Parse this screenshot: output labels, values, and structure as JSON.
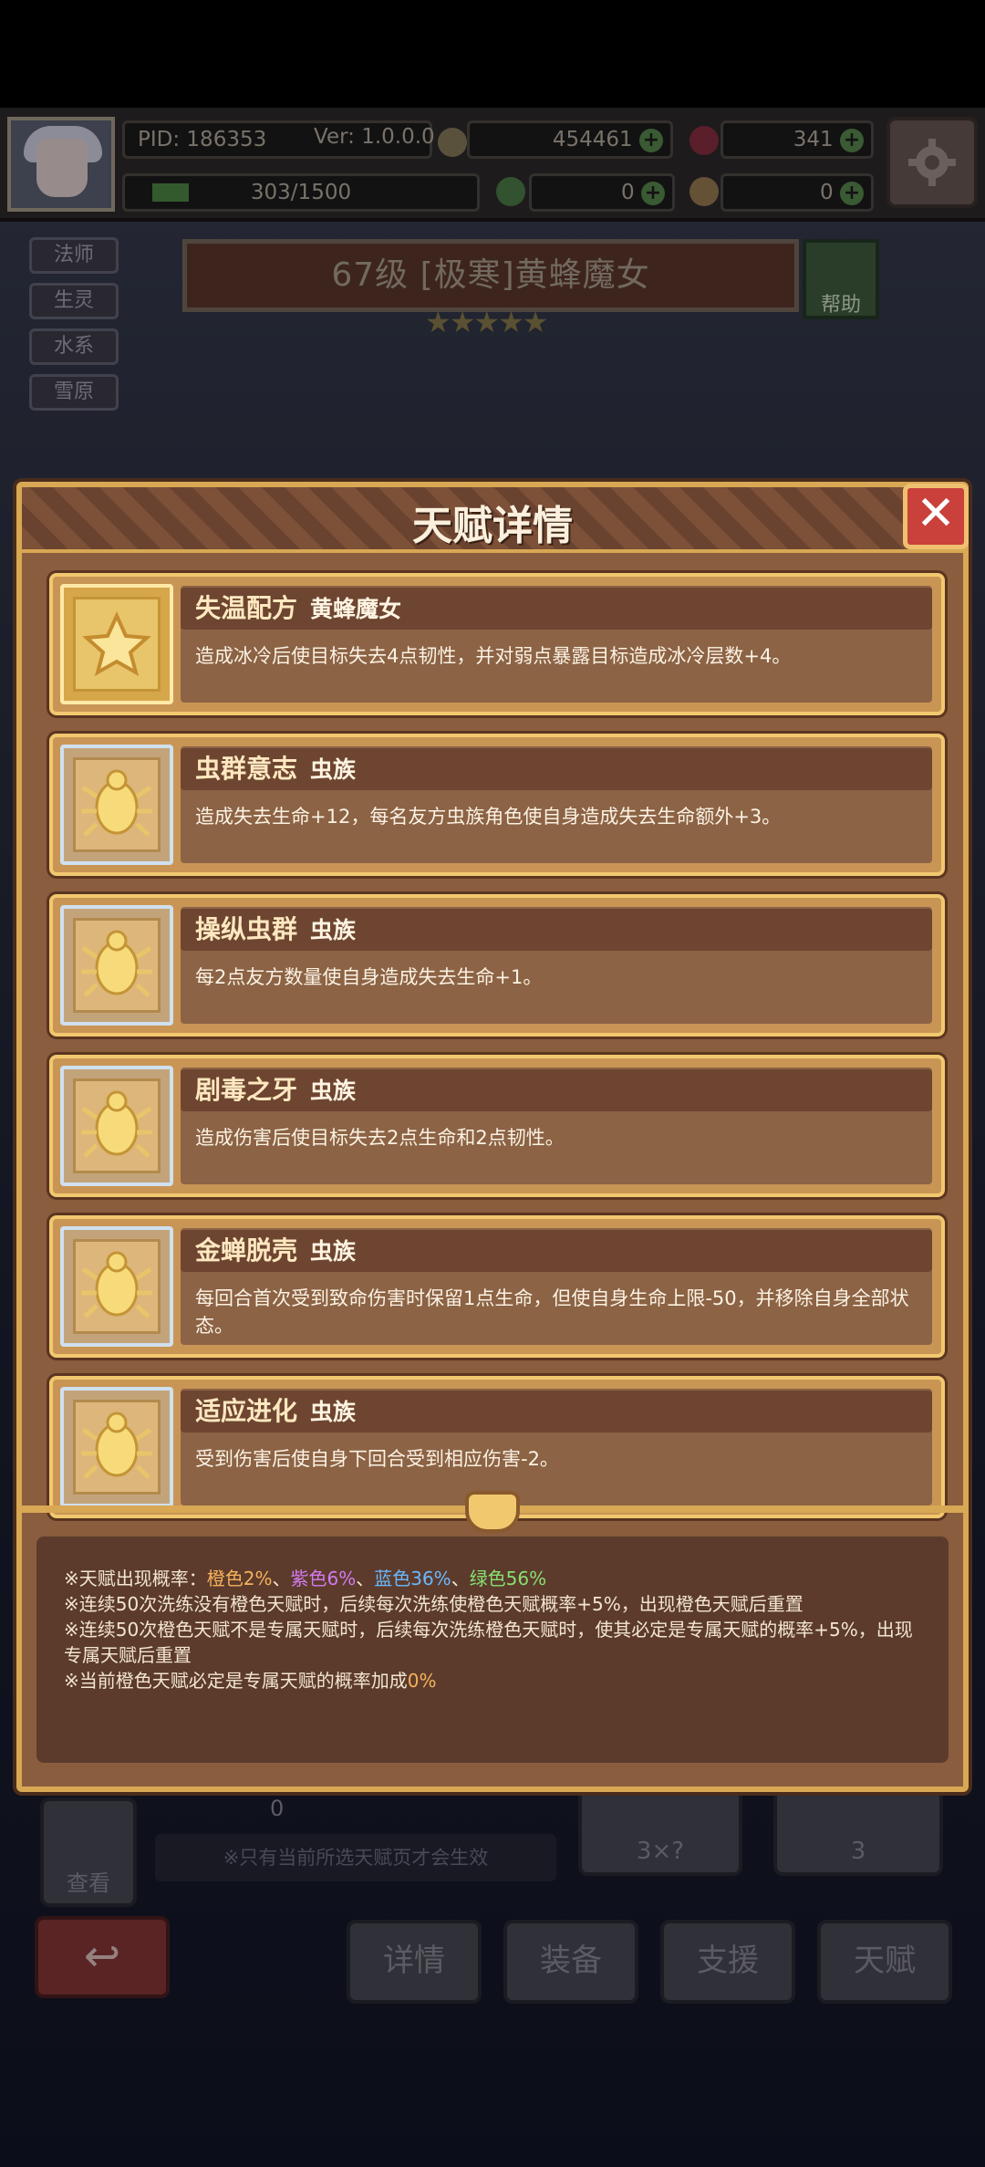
{
  "hud": {
    "pid": "PID: 186353",
    "version": "Ver: 1.0.0.0",
    "gold": "454461",
    "gems": "341",
    "exp": "303/1500",
    "clover": "0",
    "material": "0"
  },
  "tags": [
    "法师",
    "生灵",
    "水系",
    "雪原"
  ],
  "hero": {
    "title": "67级  [极寒]黄蜂魔女",
    "stars": "★★★★★",
    "help_label": "帮助"
  },
  "modal": {
    "title": "天赋详情",
    "close_label": "✕",
    "cards": [
      {
        "name": "失温配方",
        "sub": "黄蜂魔女",
        "desc": "造成冰冷后使目标失去4点韧性，并对弱点暴露目标造成冰冷层数+4。",
        "icon": "star-icon"
      },
      {
        "name": "虫群意志",
        "sub": "虫族",
        "desc": "造成失去生命+12，每名友方虫族角色使自身造成失去生命额外+3。",
        "icon": "beetle-icon"
      },
      {
        "name": "操纵虫群",
        "sub": "虫族",
        "desc": "每2点友方数量使自身造成失去生命+1。",
        "icon": "beetle-icon"
      },
      {
        "name": "剧毒之牙",
        "sub": "虫族",
        "desc": "造成伤害后使目标失去2点生命和2点韧性。",
        "icon": "beetle-icon"
      },
      {
        "name": "金蝉脱壳",
        "sub": "虫族",
        "desc": "每回合首次受到致命伤害时保留1点生命，但使自身生命上限-50，并移除自身全部状态。",
        "icon": "beetle-icon"
      },
      {
        "name": "适应进化",
        "sub": "虫族",
        "desc": "受到伤害后使自身下回合受到相应伤害-2。",
        "icon": "beetle-icon"
      }
    ],
    "info": {
      "line1_prefix": "※天赋出现概率：",
      "orange": "橙色2%",
      "sep1": "、",
      "purple": "紫色6%",
      "sep2": "、",
      "blue": "蓝色36%",
      "sep3": "、",
      "green": "绿色56%",
      "line2": "※连续50次洗练没有橙色天赋时，后续每次洗练使橙色天赋概率+5%，出现橙色天赋后重置",
      "line3": "※连续50次橙色天赋不是专属天赋时，后续每次洗练橙色天赋时，使其必定是专属天赋的概率+5%，出现专属天赋后重置",
      "line4_prefix": "※当前橙色天赋必定是专属天赋的概率加成",
      "line4_value": "0%"
    }
  },
  "under": {
    "look_label": "查看",
    "count": "0",
    "note": "※只有当前所选天赋页才会生效",
    "reroll_cost": "3×?",
    "reroll_cost2": "3",
    "tabs": [
      "详情",
      "装备",
      "支援",
      "天赋"
    ]
  }
}
